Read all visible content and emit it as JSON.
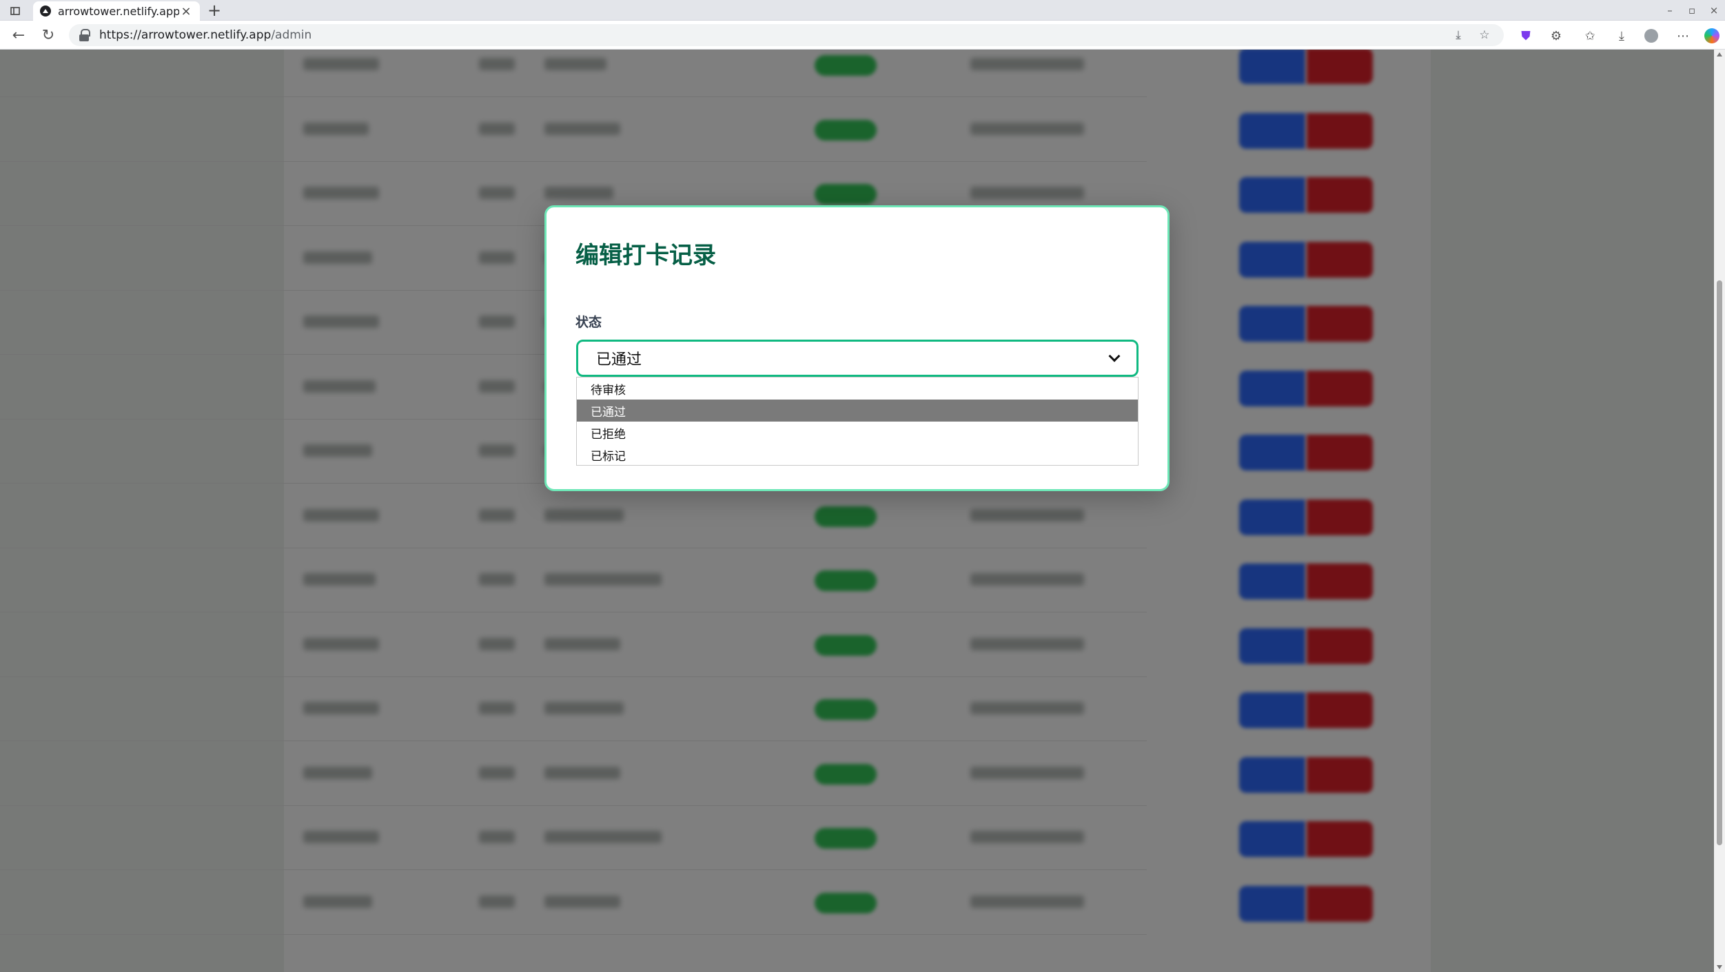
{
  "browser": {
    "tab_title": "arrowtower.netlify.app/admin",
    "url_host": "https://arrowtower.netlify.app",
    "url_path": "/admin"
  },
  "table": {
    "row_count": 14,
    "status_color": "#34c759",
    "edit_color": "#2f6bff",
    "delete_color": "#e0202a"
  },
  "modal": {
    "title": "编辑打卡记录",
    "status_label": "状态",
    "selected_value": "已通过",
    "options": [
      "待审核",
      "已通过",
      "已拒绝",
      "已标记"
    ],
    "accent_color": "#10b981"
  }
}
